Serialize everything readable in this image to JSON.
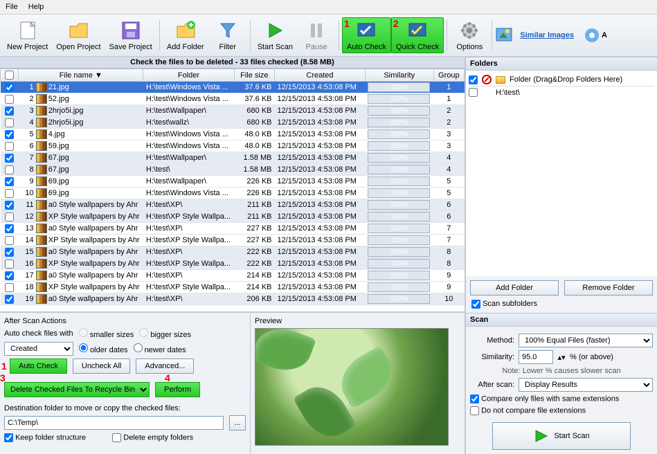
{
  "menu": {
    "file": "File",
    "help": "Help"
  },
  "toolbar": {
    "new_project": "New Project",
    "open_project": "Open Project",
    "save_project": "Save Project",
    "add_folder": "Add Folder",
    "filter": "Filter",
    "start_scan": "Start Scan",
    "pause": "Pause",
    "auto_check": "Auto Check",
    "quick_check": "Quick Check",
    "options": "Options",
    "similar_images": "Similar Images",
    "last_letter": "A"
  },
  "status": "Check the files to be deleted - 33 files checked (8.58 MB)",
  "columns": {
    "name": "File name",
    "folder": "Folder",
    "size": "File size",
    "created": "Created",
    "sim": "Similarity",
    "group": "Group"
  },
  "rows": [
    {
      "checked": true,
      "n": 1,
      "name": "21.jpg",
      "folder": "H:\\test\\Windows Vista ...",
      "size": "37.6 KB",
      "created": "12/15/2013 4:53:08 PM",
      "sim": "100%",
      "group": 1,
      "sel": true
    },
    {
      "checked": false,
      "n": 2,
      "name": "52.jpg",
      "folder": "H:\\test\\Windows Vista ...",
      "size": "37.6 KB",
      "created": "12/15/2013 4:53:08 PM",
      "sim": "100%",
      "group": 1
    },
    {
      "checked": true,
      "n": 3,
      "name": "2hrjo5i.jpg",
      "folder": "H:\\test\\Wallpaper\\",
      "size": "680 KB",
      "created": "12/15/2013 4:53:08 PM",
      "sim": "100%",
      "group": 2,
      "alt": true
    },
    {
      "checked": false,
      "n": 4,
      "name": "2hrjo5i.jpg",
      "folder": "H:\\test\\wallz\\",
      "size": "680 KB",
      "created": "12/15/2013 4:53:08 PM",
      "sim": "100%",
      "group": 2,
      "alt": true
    },
    {
      "checked": true,
      "n": 5,
      "name": "4.jpg",
      "folder": "H:\\test\\Windows Vista ...",
      "size": "48.0 KB",
      "created": "12/15/2013 4:53:08 PM",
      "sim": "100%",
      "group": 3
    },
    {
      "checked": false,
      "n": 6,
      "name": "59.jpg",
      "folder": "H:\\test\\Windows Vista ...",
      "size": "48.0 KB",
      "created": "12/15/2013 4:53:08 PM",
      "sim": "100%",
      "group": 3
    },
    {
      "checked": true,
      "n": 7,
      "name": "67.jpg",
      "folder": "H:\\test\\Wallpaper\\",
      "size": "1.58 MB",
      "created": "12/15/2013 4:53:08 PM",
      "sim": "100%",
      "group": 4,
      "alt": true
    },
    {
      "checked": false,
      "n": 8,
      "name": "67.jpg",
      "folder": "H:\\test\\",
      "size": "1.58 MB",
      "created": "12/15/2013 4:53:08 PM",
      "sim": "100%",
      "group": 4,
      "alt": true
    },
    {
      "checked": true,
      "n": 9,
      "name": "69.jpg",
      "folder": "H:\\test\\Wallpaper\\",
      "size": "226 KB",
      "created": "12/15/2013 4:53:08 PM",
      "sim": "100%",
      "group": 5
    },
    {
      "checked": false,
      "n": 10,
      "name": "69.jpg",
      "folder": "H:\\test\\Windows Vista ...",
      "size": "226 KB",
      "created": "12/15/2013 4:53:08 PM",
      "sim": "100%",
      "group": 5
    },
    {
      "checked": true,
      "n": 11,
      "name": "a0 Style wallpapers by Ahr",
      "folder": "H:\\test\\XP\\",
      "size": "211 KB",
      "created": "12/15/2013 4:53:08 PM",
      "sim": "100%",
      "group": 6,
      "alt": true
    },
    {
      "checked": false,
      "n": 12,
      "name": "XP Style wallpapers by Ahr",
      "folder": "H:\\test\\XP Style Wallpa...",
      "size": "211 KB",
      "created": "12/15/2013 4:53:08 PM",
      "sim": "100%",
      "group": 6,
      "alt": true
    },
    {
      "checked": true,
      "n": 13,
      "name": "a0 Style wallpapers by Ahr",
      "folder": "H:\\test\\XP\\",
      "size": "227 KB",
      "created": "12/15/2013 4:53:08 PM",
      "sim": "100%",
      "group": 7
    },
    {
      "checked": false,
      "n": 14,
      "name": "XP Style wallpapers by Ahr",
      "folder": "H:\\test\\XP Style Wallpa...",
      "size": "227 KB",
      "created": "12/15/2013 4:53:08 PM",
      "sim": "100%",
      "group": 7
    },
    {
      "checked": true,
      "n": 15,
      "name": "a0 Style wallpapers by Ahr",
      "folder": "H:\\test\\XP\\",
      "size": "222 KB",
      "created": "12/15/2013 4:53:08 PM",
      "sim": "100%",
      "group": 8,
      "alt": true
    },
    {
      "checked": false,
      "n": 16,
      "name": "XP Style wallpapers by Ahr",
      "folder": "H:\\test\\XP Style Wallpa...",
      "size": "222 KB",
      "created": "12/15/2013 4:53:08 PM",
      "sim": "100%",
      "group": 8,
      "alt": true
    },
    {
      "checked": true,
      "n": 17,
      "name": "a0 Style wallpapers by Ahr",
      "folder": "H:\\test\\XP\\",
      "size": "214 KB",
      "created": "12/15/2013 4:53:08 PM",
      "sim": "100%",
      "group": 9
    },
    {
      "checked": false,
      "n": 18,
      "name": "XP Style wallpapers by Ahr",
      "folder": "H:\\test\\XP Style Wallpa...",
      "size": "214 KB",
      "created": "12/15/2013 4:53:08 PM",
      "sim": "100%",
      "group": 9
    },
    {
      "checked": true,
      "n": 19,
      "name": "a0 Style wallpapers by Ahr",
      "folder": "H:\\test\\XP\\",
      "size": "206 KB",
      "created": "12/15/2013 4:53:08 PM",
      "sim": "100%",
      "group": 10,
      "alt": true
    }
  ],
  "after_scan": {
    "title": "After Scan Actions",
    "auto_check_with": "Auto check files with",
    "smaller": "smaller sizes",
    "bigger": "bigger sizes",
    "older": "older dates",
    "newer": "newer dates",
    "created": "Created",
    "auto_check_btn": "Auto Check",
    "uncheck_all": "Uncheck All",
    "advanced": "Advanced...",
    "delete_action": "Delete Checked Files To Recycle Bin",
    "perform": "Perform",
    "dest_label": "Destination folder to move or copy the checked files:",
    "dest_path": "C:\\Temp\\",
    "keep_struct": "Keep folder structure",
    "delete_empty": "Delete empty folders"
  },
  "preview": {
    "title": "Preview"
  },
  "folders_panel": {
    "title": "Folders",
    "header_hint": "Folder (Drag&Drop Folders Here)",
    "items": [
      {
        "path": "H:\\test\\",
        "checked": false
      }
    ],
    "add": "Add Folder",
    "remove": "Remove Folder",
    "scan_sub": "Scan subfolders"
  },
  "scan_panel": {
    "title": "Scan",
    "method_lbl": "Method:",
    "method_val": "100% Equal Files (faster)",
    "sim_lbl": "Similarity:",
    "sim_val": "95.0",
    "sim_suffix": "% (or above)",
    "note": "Note: Lower % causes slower scan",
    "after_lbl": "After scan:",
    "after_val": "Display Results",
    "compare_ext": "Compare only files with same extensions",
    "no_compare_ext": "Do not compare file extensions",
    "start": "Start Scan"
  },
  "step_markers": {
    "s1": "1",
    "s2": "2",
    "s3": "3",
    "s4": "4"
  }
}
